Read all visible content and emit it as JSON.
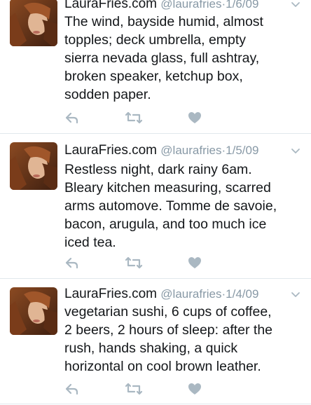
{
  "tweets": [
    {
      "name": "LauraFries.com",
      "handle": "@laurafries",
      "separator": "·",
      "date": "1/6/09",
      "lines": [
        "The wind, bayside humid, almost",
        "topples; deck umbrella, empty",
        "sierra nevada glass, full ashtray,",
        "broken speaker, ketchup box,",
        "sodden paper."
      ]
    },
    {
      "name": "LauraFries.com",
      "handle": "@laurafries",
      "separator": "·",
      "date": "1/5/09",
      "lines": [
        "Restless night, dark rainy 6am.",
        "Bleary kitchen measuring, scarred",
        "arms automove. Tomme de savoie,",
        "bacon, arugula, and too much ice",
        "iced tea."
      ]
    },
    {
      "name": "LauraFries.com",
      "handle": "@laurafries",
      "separator": "·",
      "date": "1/4/09",
      "lines": [
        "vegetarian sushi, 6 cups of coffee,",
        "2 beers, 2 hours of sleep: after the",
        "rush, hands shaking, a quick",
        "horizontal on cool brown leather."
      ]
    }
  ],
  "icons": {
    "avatar": "avatar-photo",
    "menu": "chevron-down-icon",
    "reply": "reply-icon",
    "retweet": "retweet-icon",
    "like": "heart-icon"
  },
  "colors": {
    "text": "#14171a",
    "muted": "#8899a6",
    "icon": "#aab8c2",
    "divider": "#e1e8ed"
  }
}
